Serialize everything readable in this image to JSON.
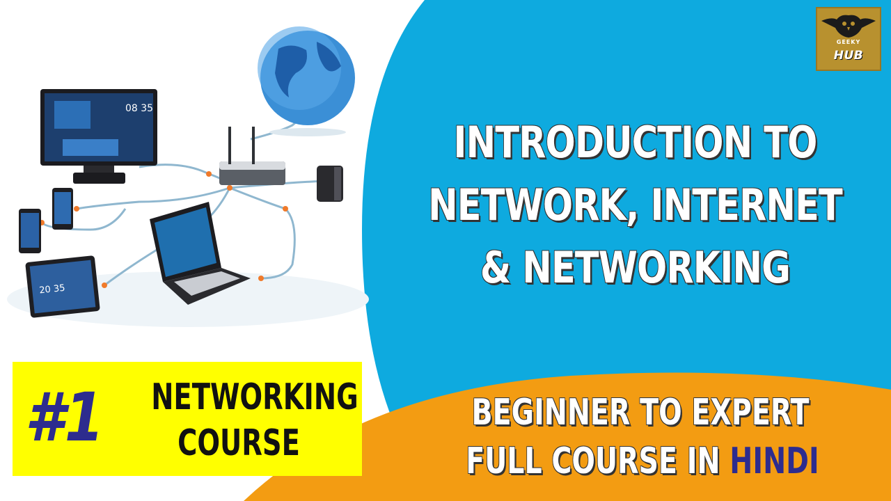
{
  "logo": {
    "text": "HUB",
    "subtext": "GEEKY"
  },
  "title": {
    "line1": "INTRODUCTION TO",
    "line2": "NETWORK, INTERNET",
    "line3": "& NETWORKING"
  },
  "badge": {
    "number": "#1",
    "line1": "NETWORKING",
    "line2": "COURSE"
  },
  "subtitle": {
    "line1": "BEGINNER TO EXPERT",
    "line2_prefix": "FULL COURSE IN ",
    "line2_highlight": "HINDI"
  },
  "colors": {
    "blue_panel": "#0eaadf",
    "orange_panel": "#f39c12",
    "badge_yellow": "#ffff00",
    "badge_number": "#2d2c8e",
    "logo_gold": "#b8912f"
  },
  "illustration": {
    "tv_time": "08 35",
    "tablet_time": "20 35"
  }
}
